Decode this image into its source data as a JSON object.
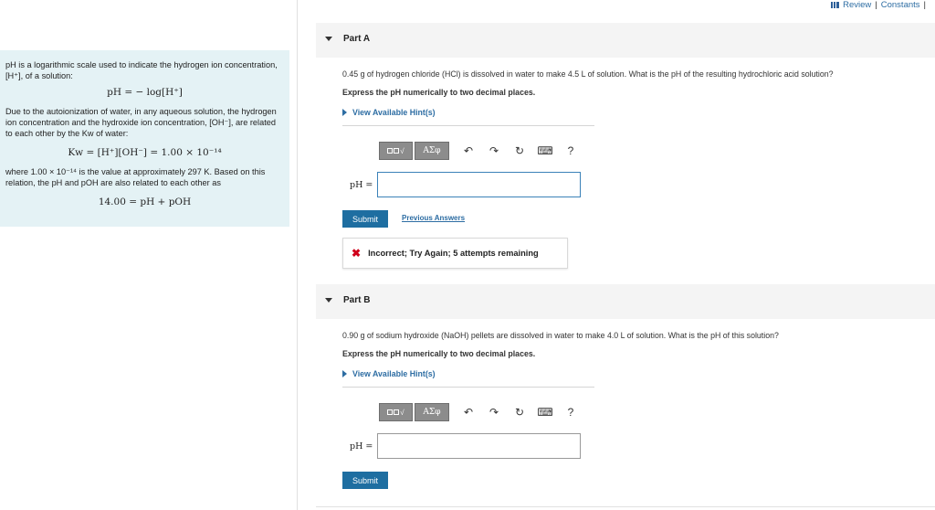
{
  "header": {
    "review_label": "Review",
    "separator": "|",
    "constants_label": "Constants",
    "trailing_separator": "|",
    "icon": "review-bars-icon"
  },
  "intro": {
    "p1": "pH is a logarithmic scale used to indicate the hydrogen ion concentration, [H⁺], of a solution:",
    "eq1": "pH = − log[H⁺]",
    "p2": "Due to the autoionization of water, in any aqueous solution, the hydrogen ion concentration and the hydroxide ion concentration, [OH⁻], are related to each other by the Kw of water:",
    "eq2": "Kw = [H⁺][OH⁻] = 1.00 × 10⁻¹⁴",
    "p3": "where 1.00 × 10⁻¹⁴ is the value at approximately 297 K. Based on this relation, the pH and pOH are also related to each other as",
    "eq3": "14.00 = pH + pOH"
  },
  "partA": {
    "title": "Part A",
    "question": "0.45 g of hydrogen chloride (HCl) is dissolved in water to make 4.5 L of solution. What is the pH of the resulting hydrochloric acid solution?",
    "instruction": "Express the pH numerically to two decimal places.",
    "hint": "View Available Hint(s)",
    "input_label": "pH =",
    "input_value": "",
    "submit_label": "Submit",
    "previous_answers_label": "Previous Answers",
    "feedback": "Incorrect; Try Again; 5 attempts remaining"
  },
  "partB": {
    "title": "Part B",
    "question": "0.90 g of sodium hydroxide (NaOH) pellets are dissolved in water to make 4.0 L of solution. What is the pH of this solution?",
    "instruction": "Express the pH numerically to two decimal places.",
    "hint": "View Available Hint(s)",
    "input_label": "pH =",
    "input_value": "",
    "submit_label": "Submit"
  },
  "toolbar": {
    "greek_label": "ΑΣφ",
    "help_label": "?",
    "icons": [
      "templates-icon",
      "greek-symbols-icon",
      "undo-icon",
      "redo-icon",
      "reset-icon",
      "keyboard-icon",
      "help-icon"
    ]
  },
  "colors": {
    "link": "#2d6da3",
    "submit_bg": "#1e6ea1",
    "intro_bg": "#e4f2f5",
    "error": "#d0021b"
  }
}
